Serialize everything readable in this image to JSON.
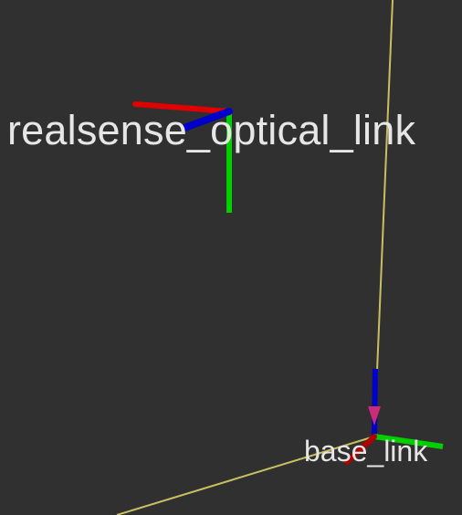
{
  "viewer": {
    "background_color": "#303030",
    "axis_colors": {
      "x": "#e00000",
      "y": "#00d000",
      "z": "#0000c8"
    },
    "connection_line_color": "#c8c060",
    "arrow_color": "#cc2a7a"
  },
  "frames": {
    "realsense_optical_link": {
      "label": "realsense_optical_link"
    },
    "base_link": {
      "label": "base_link"
    }
  }
}
